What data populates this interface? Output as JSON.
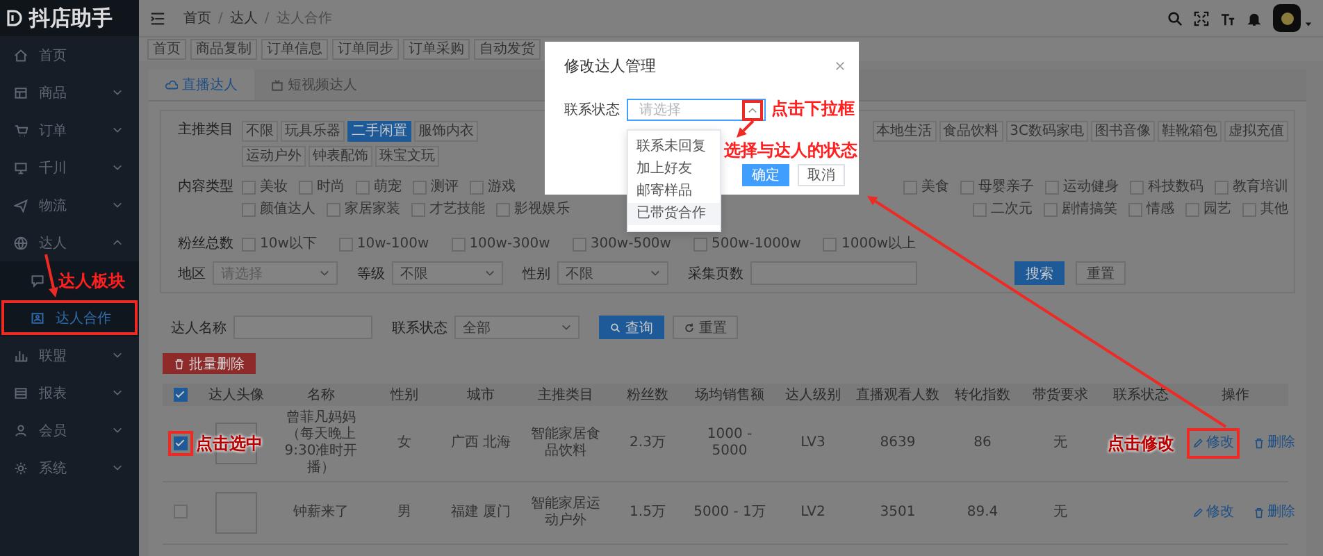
{
  "sidebar": {
    "logo": "抖店助手",
    "annotation": "达人板块",
    "items": [
      {
        "label": "首页",
        "kind": "link"
      },
      {
        "label": "商品",
        "kind": "menu",
        "expanded": false
      },
      {
        "label": "订单",
        "kind": "menu",
        "expanded": false
      },
      {
        "label": "千川",
        "kind": "menu",
        "expanded": false
      },
      {
        "label": "物流",
        "kind": "menu",
        "expanded": false
      },
      {
        "label": "达人",
        "kind": "menu",
        "expanded": true,
        "children": [
          {
            "selected": false,
            "highlighted": false
          },
          {
            "label": "达人合作",
            "selected": true,
            "highlighted": true
          }
        ]
      },
      {
        "label": "联盟",
        "kind": "menu",
        "expanded": false
      },
      {
        "label": "报表",
        "kind": "menu",
        "expanded": false
      },
      {
        "label": "会员",
        "kind": "menu",
        "expanded": false
      },
      {
        "label": "系统",
        "kind": "menu",
        "expanded": false
      }
    ]
  },
  "breadcrumb": {
    "separator": "/",
    "items": [
      "首页",
      "达人",
      "达人合作"
    ]
  },
  "tags": [
    "首页",
    "商品复制",
    "订单信息",
    "订单同步",
    "订单采购",
    "自动发货"
  ],
  "tabs": [
    {
      "label": "直播达人",
      "selected": true
    },
    {
      "label": "短视频达人",
      "selected": false
    }
  ],
  "filters": {
    "main_category": {
      "label": "主推类目",
      "rows": [
        {
          "start": [
            {
              "label": "不限",
              "selected": false
            },
            {
              "label": "玩具乐器",
              "selected": false
            },
            {
              "label": "二手闲置",
              "selected": true
            },
            {
              "label": "服饰内衣",
              "selected": false
            }
          ],
          "end": [
            {
              "label": "本地生活",
              "selected": false
            },
            {
              "label": "食品饮料",
              "selected": false
            },
            {
              "label": "3C数码家电",
              "selected": false
            },
            {
              "label": "图书音像",
              "selected": false
            },
            {
              "label": "鞋靴箱包",
              "selected": false
            },
            {
              "label": "虚拟充值",
              "selected": false
            }
          ]
        },
        {
          "start": [
            {
              "label": "运动户外",
              "selected": false
            },
            {
              "label": "钟表配饰",
              "selected": false
            },
            {
              "label": "珠宝文玩",
              "selected": false
            }
          ],
          "end": []
        }
      ]
    },
    "content_type": {
      "label": "内容类型",
      "rows": [
        {
          "start": [
            {
              "label": "美妆",
              "checked": false
            },
            {
              "label": "时尚",
              "checked": false
            },
            {
              "label": "萌宠",
              "checked": false
            },
            {
              "label": "测评",
              "checked": false
            },
            {
              "label": "游戏",
              "checked": false
            }
          ],
          "end": [
            {
              "label": "美食",
              "checked": false
            },
            {
              "label": "母婴亲子",
              "checked": false
            },
            {
              "label": "运动健身",
              "checked": false
            },
            {
              "label": "科技数码",
              "checked": false
            },
            {
              "label": "教育培训",
              "checked": false
            }
          ]
        },
        {
          "start": [
            {
              "label": "颜值达人",
              "checked": false
            },
            {
              "label": "家居家装",
              "checked": false
            },
            {
              "label": "才艺技能",
              "checked": false
            },
            {
              "label": "影视娱乐",
              "checked": false
            }
          ],
          "end": [
            {
              "label": "二次元",
              "checked": false
            },
            {
              "label": "剧情搞笑",
              "checked": false
            },
            {
              "label": "情感",
              "checked": false
            },
            {
              "label": "园艺",
              "checked": false
            },
            {
              "label": "其他",
              "checked": false
            }
          ]
        }
      ]
    },
    "fan_count": {
      "label": "粉丝总数",
      "options": [
        {
          "label": "10w以下",
          "checked": false
        },
        {
          "label": "10w-100w",
          "checked": false
        },
        {
          "label": "100w-300w",
          "checked": false
        },
        {
          "label": "300w-500w",
          "checked": false
        },
        {
          "label": "500w-1000w",
          "checked": false
        },
        {
          "label": "1000w以上",
          "checked": false
        }
      ]
    },
    "fields": [
      {
        "label": "地区",
        "kind": "select",
        "placeholder": "请选择"
      },
      {
        "label": "等级",
        "kind": "select",
        "value": "不限"
      },
      {
        "label": "性别",
        "kind": "select",
        "value": "不限"
      },
      {
        "label": "采集页数",
        "kind": "input"
      }
    ],
    "buttons": [
      {
        "label": "搜索",
        "kind": "primary"
      },
      {
        "label": "重置",
        "kind": "default"
      }
    ]
  },
  "query": {
    "fields": [
      {
        "label": "达人名称",
        "kind": "input"
      },
      {
        "label": "联系状态",
        "kind": "select",
        "value": "全部"
      }
    ],
    "buttons": [
      {
        "label": "查询",
        "kind": "primary"
      },
      {
        "label": "重置",
        "kind": "default"
      }
    ]
  },
  "batch_delete": "批量删除",
  "table": {
    "header_checked": true,
    "columns": [
      "达人头像",
      "名称",
      "性别",
      "城市",
      "主推类目",
      "粉丝数",
      "场均销售额",
      "达人级别",
      "直播观看人数",
      "转化指数",
      "带货要求",
      "联系状态",
      "操作"
    ],
    "rows": [
      {
        "checked": true,
        "checkbox_highlighted": true,
        "annotation": "点击选中",
        "name": "曾菲凡妈妈（每天晚上9:30准时开播）",
        "gender": "女",
        "city": "广西 北海",
        "category": "智能家居食品饮料",
        "fans": "2.3万",
        "avg_sales": "1000 - 5000",
        "level": "LV3",
        "viewers": "8639",
        "conversion": "86",
        "requirement": "无",
        "status_annotation": "点击修改",
        "edit_highlighted": true,
        "actions": [
          {
            "label": "修改",
            "kind": "edit"
          },
          {
            "label": "删除",
            "kind": "delete"
          }
        ]
      },
      {
        "checked": false,
        "checkbox_highlighted": false,
        "name": "钟薪来了",
        "gender": "男",
        "city": "福建 厦门",
        "category": "智能家居运动户外",
        "fans": "1.5万",
        "avg_sales": "5000 - 1万",
        "level": "LV2",
        "viewers": "3501",
        "conversion": "89.4",
        "requirement": "无",
        "edit_highlighted": false,
        "actions": [
          {
            "label": "修改",
            "kind": "edit"
          },
          {
            "label": "删除",
            "kind": "delete"
          }
        ]
      }
    ]
  },
  "dialog": {
    "title": "修改达人管理",
    "field_label": "联系状态",
    "placeholder": "请选择",
    "open": true,
    "chevron_highlighted": true,
    "annotation": "点击下拉框",
    "options_annotation": "选择与达人的状态",
    "options": [
      {
        "label": "联系未回复",
        "hovered": false
      },
      {
        "label": "加上好友",
        "hovered": false
      },
      {
        "label": "邮寄样品",
        "hovered": false
      },
      {
        "label": "已带货合作",
        "hovered": true
      }
    ],
    "buttons": [
      {
        "label": "确定",
        "kind": "primary"
      },
      {
        "label": "取消",
        "kind": "default"
      }
    ]
  }
}
